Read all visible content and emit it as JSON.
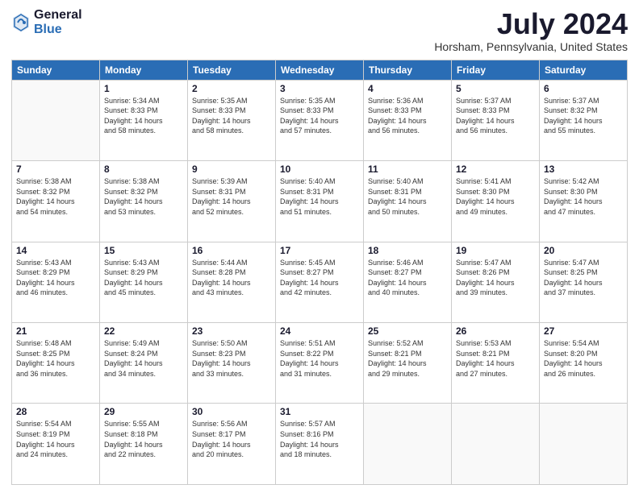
{
  "logo": {
    "general": "General",
    "blue": "Blue"
  },
  "header": {
    "title": "July 2024",
    "location": "Horsham, Pennsylvania, United States"
  },
  "weekdays": [
    "Sunday",
    "Monday",
    "Tuesday",
    "Wednesday",
    "Thursday",
    "Friday",
    "Saturday"
  ],
  "weeks": [
    [
      {
        "day": "",
        "info": ""
      },
      {
        "day": "1",
        "info": "Sunrise: 5:34 AM\nSunset: 8:33 PM\nDaylight: 14 hours\nand 58 minutes."
      },
      {
        "day": "2",
        "info": "Sunrise: 5:35 AM\nSunset: 8:33 PM\nDaylight: 14 hours\nand 58 minutes."
      },
      {
        "day": "3",
        "info": "Sunrise: 5:35 AM\nSunset: 8:33 PM\nDaylight: 14 hours\nand 57 minutes."
      },
      {
        "day": "4",
        "info": "Sunrise: 5:36 AM\nSunset: 8:33 PM\nDaylight: 14 hours\nand 56 minutes."
      },
      {
        "day": "5",
        "info": "Sunrise: 5:37 AM\nSunset: 8:33 PM\nDaylight: 14 hours\nand 56 minutes."
      },
      {
        "day": "6",
        "info": "Sunrise: 5:37 AM\nSunset: 8:32 PM\nDaylight: 14 hours\nand 55 minutes."
      }
    ],
    [
      {
        "day": "7",
        "info": "Sunrise: 5:38 AM\nSunset: 8:32 PM\nDaylight: 14 hours\nand 54 minutes."
      },
      {
        "day": "8",
        "info": "Sunrise: 5:38 AM\nSunset: 8:32 PM\nDaylight: 14 hours\nand 53 minutes."
      },
      {
        "day": "9",
        "info": "Sunrise: 5:39 AM\nSunset: 8:31 PM\nDaylight: 14 hours\nand 52 minutes."
      },
      {
        "day": "10",
        "info": "Sunrise: 5:40 AM\nSunset: 8:31 PM\nDaylight: 14 hours\nand 51 minutes."
      },
      {
        "day": "11",
        "info": "Sunrise: 5:40 AM\nSunset: 8:31 PM\nDaylight: 14 hours\nand 50 minutes."
      },
      {
        "day": "12",
        "info": "Sunrise: 5:41 AM\nSunset: 8:30 PM\nDaylight: 14 hours\nand 49 minutes."
      },
      {
        "day": "13",
        "info": "Sunrise: 5:42 AM\nSunset: 8:30 PM\nDaylight: 14 hours\nand 47 minutes."
      }
    ],
    [
      {
        "day": "14",
        "info": "Sunrise: 5:43 AM\nSunset: 8:29 PM\nDaylight: 14 hours\nand 46 minutes."
      },
      {
        "day": "15",
        "info": "Sunrise: 5:43 AM\nSunset: 8:29 PM\nDaylight: 14 hours\nand 45 minutes."
      },
      {
        "day": "16",
        "info": "Sunrise: 5:44 AM\nSunset: 8:28 PM\nDaylight: 14 hours\nand 43 minutes."
      },
      {
        "day": "17",
        "info": "Sunrise: 5:45 AM\nSunset: 8:27 PM\nDaylight: 14 hours\nand 42 minutes."
      },
      {
        "day": "18",
        "info": "Sunrise: 5:46 AM\nSunset: 8:27 PM\nDaylight: 14 hours\nand 40 minutes."
      },
      {
        "day": "19",
        "info": "Sunrise: 5:47 AM\nSunset: 8:26 PM\nDaylight: 14 hours\nand 39 minutes."
      },
      {
        "day": "20",
        "info": "Sunrise: 5:47 AM\nSunset: 8:25 PM\nDaylight: 14 hours\nand 37 minutes."
      }
    ],
    [
      {
        "day": "21",
        "info": "Sunrise: 5:48 AM\nSunset: 8:25 PM\nDaylight: 14 hours\nand 36 minutes."
      },
      {
        "day": "22",
        "info": "Sunrise: 5:49 AM\nSunset: 8:24 PM\nDaylight: 14 hours\nand 34 minutes."
      },
      {
        "day": "23",
        "info": "Sunrise: 5:50 AM\nSunset: 8:23 PM\nDaylight: 14 hours\nand 33 minutes."
      },
      {
        "day": "24",
        "info": "Sunrise: 5:51 AM\nSunset: 8:22 PM\nDaylight: 14 hours\nand 31 minutes."
      },
      {
        "day": "25",
        "info": "Sunrise: 5:52 AM\nSunset: 8:21 PM\nDaylight: 14 hours\nand 29 minutes."
      },
      {
        "day": "26",
        "info": "Sunrise: 5:53 AM\nSunset: 8:21 PM\nDaylight: 14 hours\nand 27 minutes."
      },
      {
        "day": "27",
        "info": "Sunrise: 5:54 AM\nSunset: 8:20 PM\nDaylight: 14 hours\nand 26 minutes."
      }
    ],
    [
      {
        "day": "28",
        "info": "Sunrise: 5:54 AM\nSunset: 8:19 PM\nDaylight: 14 hours\nand 24 minutes."
      },
      {
        "day": "29",
        "info": "Sunrise: 5:55 AM\nSunset: 8:18 PM\nDaylight: 14 hours\nand 22 minutes."
      },
      {
        "day": "30",
        "info": "Sunrise: 5:56 AM\nSunset: 8:17 PM\nDaylight: 14 hours\nand 20 minutes."
      },
      {
        "day": "31",
        "info": "Sunrise: 5:57 AM\nSunset: 8:16 PM\nDaylight: 14 hours\nand 18 minutes."
      },
      {
        "day": "",
        "info": ""
      },
      {
        "day": "",
        "info": ""
      },
      {
        "day": "",
        "info": ""
      }
    ]
  ]
}
